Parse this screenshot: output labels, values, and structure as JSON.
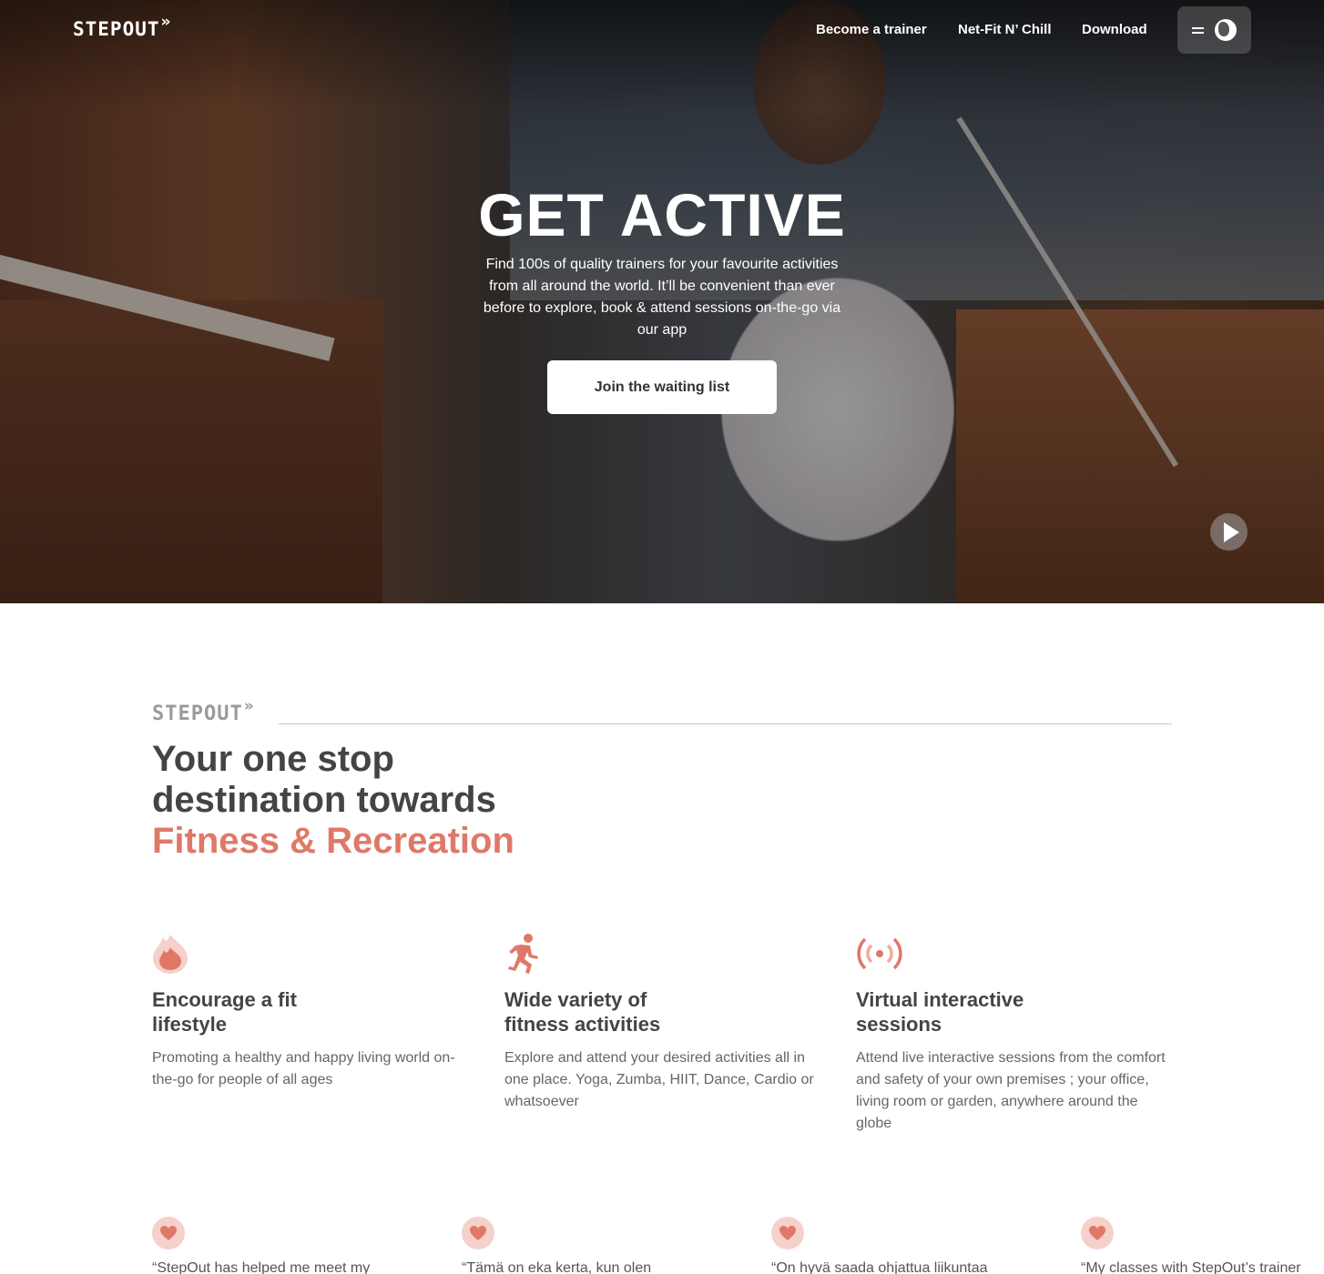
{
  "brand": {
    "logo_text": "STEPOUT",
    "logo_chevrons": "››"
  },
  "nav": {
    "links": [
      {
        "label": "Become a trainer"
      },
      {
        "label": "Net-Fit N’ Chill"
      },
      {
        "label": "Download"
      }
    ],
    "menu_icon": "menu-icon",
    "language_icon": "globe-icon"
  },
  "hero": {
    "title": "GET ACTIVE",
    "subtitle": "Find 100s of quality trainers for your favourite activities from all around the world. It’ll be convenient than ever before to explore, book & attend sessions on-the-go via our app",
    "cta_label": "Join the waiting list",
    "play_icon": "play-icon"
  },
  "section": {
    "headline_line1": "Your one stop",
    "headline_line2": "destination towards",
    "headline_accent": "Fitness & Recreation"
  },
  "features": [
    {
      "icon": "flame-icon",
      "title_line1": "Encourage a fit",
      "title_line2": "lifestyle",
      "text": "Promoting a healthy and happy living world on-the-go for people of all ages"
    },
    {
      "icon": "running-person-icon",
      "title_line1": "Wide variety of",
      "title_line2": "fitness activities",
      "text": "Explore and attend your desired activities all in one place. Yoga, Zumba, HIIT, Dance, Cardio or whatsoever"
    },
    {
      "icon": "broadcast-icon",
      "title_line1": "Virtual interactive",
      "title_line2": "sessions",
      "text": "Attend live interactive sessions from the comfort and safety of your own premises ; your office, living room or garden, anywhere around the globe"
    }
  ],
  "testimonials": [
    {
      "icon": "heart-icon",
      "text": "“StepOut has helped me meet my"
    },
    {
      "icon": "heart-icon",
      "text": "“Tämä on eka kerta, kun olen"
    },
    {
      "icon": "heart-icon",
      "text": "“On hyvä saada ohjattua liikuntaa"
    },
    {
      "icon": "heart-icon",
      "text": "“My classes with StepOut’s trainer"
    }
  ],
  "colors": {
    "accent": "#e07868",
    "accent_light": "#f6d0cb",
    "text_dark": "#444444",
    "text_body": "#666666"
  }
}
